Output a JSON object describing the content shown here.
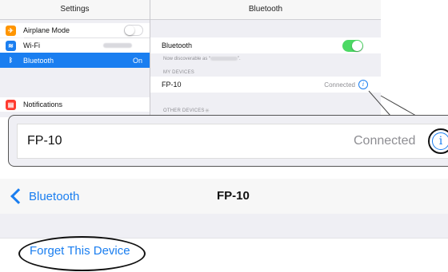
{
  "settings": {
    "title": "Settings",
    "items": [
      {
        "label": "Airplane Mode",
        "icon": "airplane-icon",
        "color": "#ff9500"
      },
      {
        "label": "Wi-Fi",
        "icon": "wifi-icon",
        "color": "#1a7ef0"
      },
      {
        "label": "Bluetooth",
        "icon": "bluetooth-icon",
        "color": "#1a7ef0",
        "value": "On",
        "selected": true
      },
      {
        "label": "Notifications",
        "icon": "notifications-icon",
        "color": "#ff3b30"
      }
    ]
  },
  "bluetooth_panel": {
    "title": "Bluetooth",
    "toggle_label": "Bluetooth",
    "discoverable_text": "Now discoverable as “",
    "discoverable_suffix": "”.",
    "my_devices_header": "MY DEVICES",
    "device_name": "FP-10",
    "device_status": "Connected",
    "other_devices_header": "OTHER DEVICES"
  },
  "zoom": {
    "device_name": "FP-10",
    "device_status": "Connected"
  },
  "detail": {
    "back_label": "Bluetooth",
    "title": "FP-10",
    "forget_label": "Forget This Device"
  },
  "colors": {
    "accent": "#1a7ef0",
    "toggle_on": "#4cd964"
  }
}
